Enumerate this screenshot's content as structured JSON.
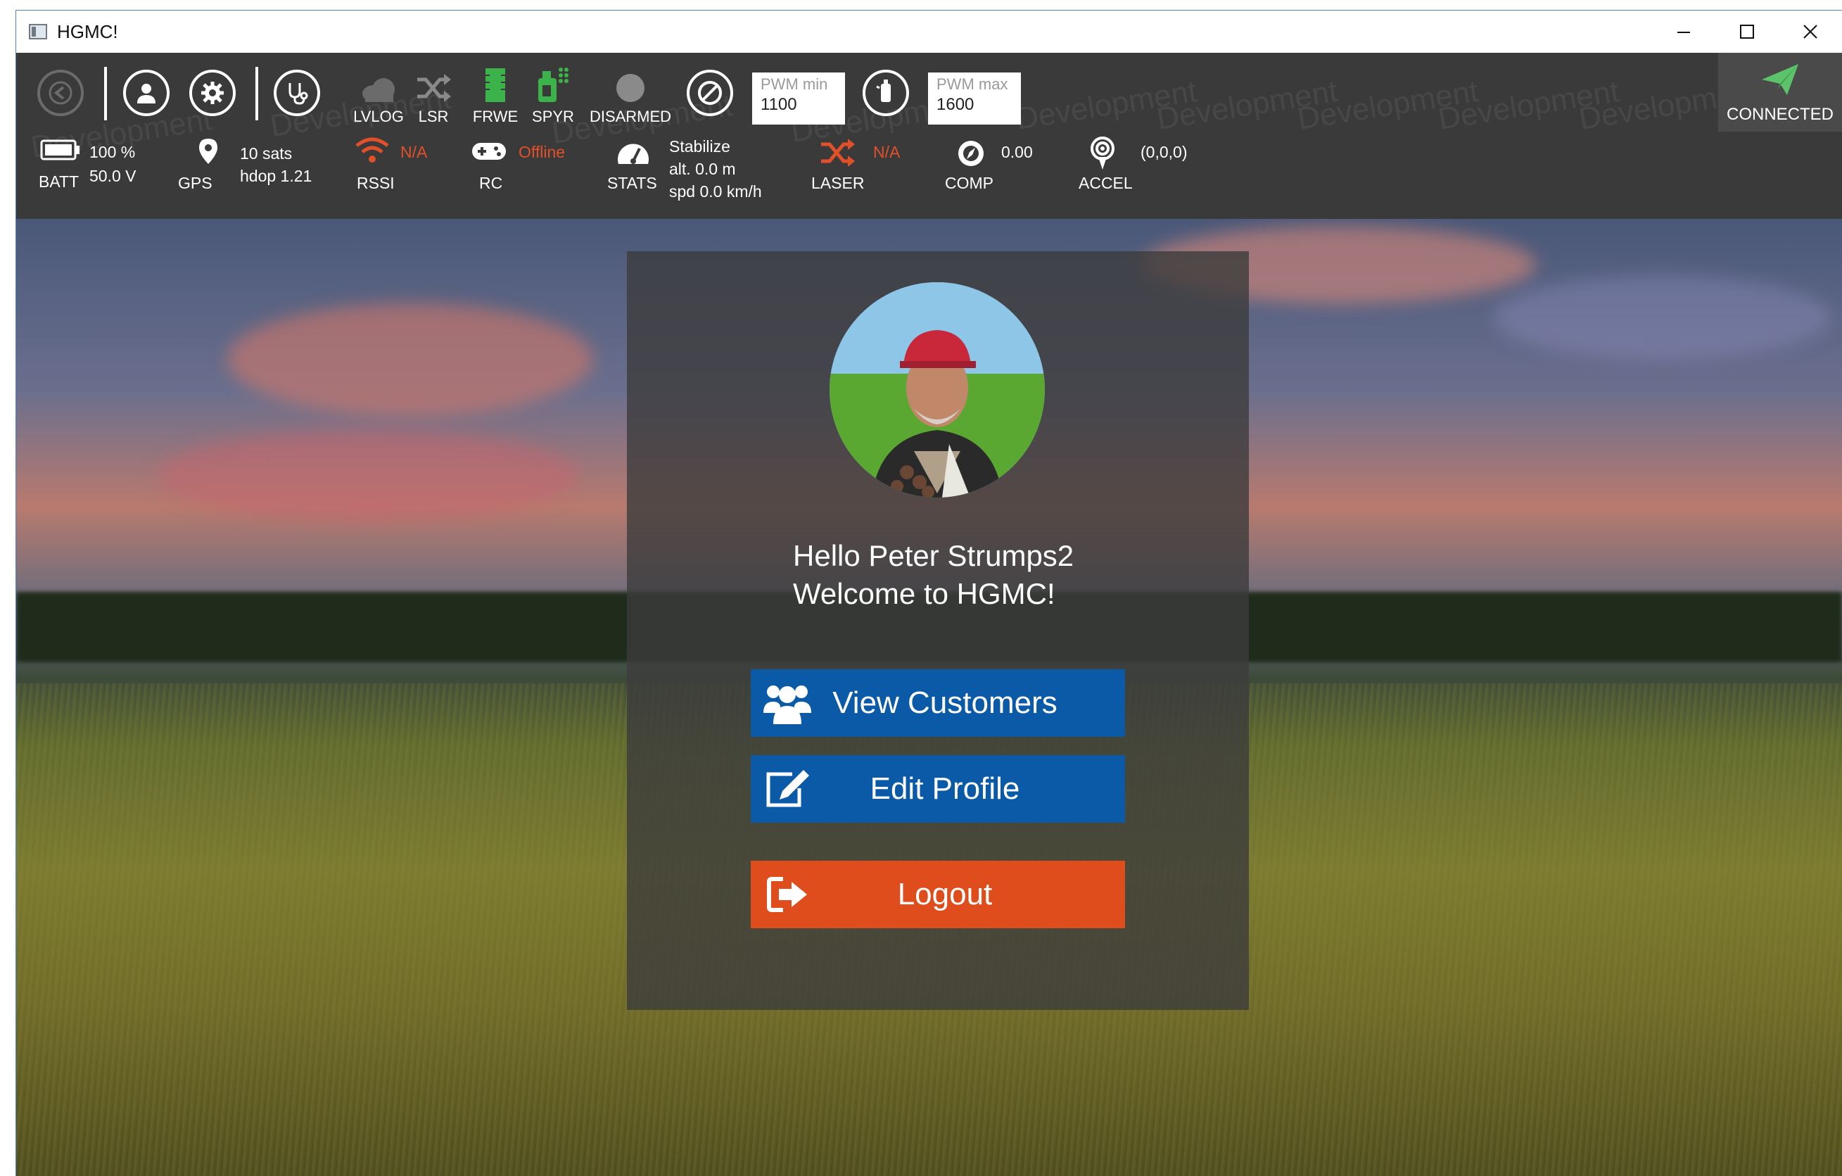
{
  "window": {
    "title": "HGMC!"
  },
  "toolbar": {
    "watermark": "Development",
    "tools": [
      {
        "id": "lvlog",
        "label": "LVLOG",
        "icon": "cloud-icon"
      },
      {
        "id": "lsr",
        "label": "LSR",
        "icon": "shuffle-icon"
      },
      {
        "id": "frwe",
        "label": "FRWE",
        "icon": "chip-icon"
      },
      {
        "id": "spyr",
        "label": "SPYR",
        "icon": "sprayer-icon"
      },
      {
        "id": "disarmed",
        "label": "DISARMED",
        "icon": "status-dot-icon"
      }
    ],
    "pwm_min": {
      "label": "PWM min",
      "value": "1100"
    },
    "pwm_max": {
      "label": "PWM max",
      "value": "1600"
    },
    "connection": {
      "label": "CONNECTED",
      "icon": "paper-plane-icon",
      "color": "#5cc36a"
    },
    "accent_green": "#3cb34a",
    "alert_color": "#e2502a"
  },
  "status": {
    "batt": {
      "label": "BATT",
      "percent": "100 %",
      "voltage": "50.0 V"
    },
    "gps": {
      "label": "GPS",
      "sats": "10 sats",
      "hdop": "hdop 1.21"
    },
    "rssi": {
      "label": "RSSI",
      "value": "N/A"
    },
    "rc": {
      "label": "RC",
      "value": "Offline"
    },
    "stats": {
      "label": "STATS",
      "mode": "Stabilize",
      "alt": "alt. 0.0 m",
      "spd": "spd 0.0 km/h"
    },
    "laser": {
      "label": "LASER",
      "value": "N/A"
    },
    "comp": {
      "label": "COMP",
      "value": "0.00"
    },
    "accel": {
      "label": "ACCEL",
      "value": "(0,0,0)"
    }
  },
  "panel": {
    "greeting_line1": "Hello Peter Strumps2",
    "greeting_line2": "Welcome to HGMC!",
    "buttons": {
      "view_customers": "View Customers",
      "edit_profile": "Edit Profile",
      "logout": "Logout"
    },
    "button_blue": "#0b5aa8",
    "button_orange": "#e04d1c"
  }
}
